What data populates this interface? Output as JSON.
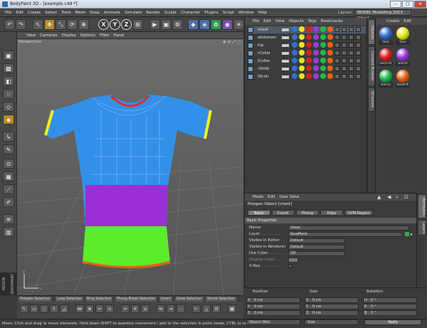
{
  "window": {
    "title": "BodyPaint 3D - [example.c4d *]",
    "min": "–",
    "max": "□",
    "close": "✕"
  },
  "menu": {
    "items": [
      "File",
      "Edit",
      "Create",
      "Select",
      "Tools",
      "Mesh",
      "Snap",
      "Animate",
      "Simulate",
      "Render",
      "Sculpt",
      "Character",
      "Plugins",
      "Script",
      "Window",
      "Help"
    ],
    "layout_label": "Layout:",
    "layout_value": "MODEL Modelling 2013 (User)"
  },
  "toolbar": {
    "icons": [
      "undo-icon",
      "redo-icon",
      "select-arrow-icon",
      "move-icon",
      "scale-icon",
      "rotate-icon",
      "transform-icon",
      "x-axis-icon",
      "y-axis-icon",
      "z-axis-icon",
      "world-coords-icon",
      "render-view-icon",
      "render-picture-icon",
      "edit-render-settings-icon",
      "render-queue-icon",
      "cube-icon",
      "subdivision-icon",
      "array-icon",
      "spline-icon",
      "deformer-icon",
      "scene-icon",
      "light-icon"
    ],
    "x": "X",
    "y": "Y",
    "z": "Z"
  },
  "viewport": {
    "menu": [
      "View",
      "Cameras",
      "Display",
      "Options",
      "Filter",
      "Panel"
    ],
    "label": "Perspective",
    "nav": "✥ ⟳ ⤢ ▢"
  },
  "objects": {
    "menu": [
      "File",
      "Edit",
      "View",
      "Objects",
      "Tags",
      "Bookmarks"
    ],
    "rows": [
      "chest",
      "abdomen",
      "hip",
      "rCollar",
      "lCollar",
      "rShldr",
      "lShldr"
    ]
  },
  "materials": {
    "menu": [
      "Create",
      "Edit"
    ],
    "items": [
      {
        "name": "face",
        "color": "#2f6fd6"
      },
      {
        "name": "face",
        "color": "#e8e81a"
      },
      {
        "name": "neck-sh",
        "color": "#e11d1d"
      },
      {
        "name": "waist2",
        "color": "#9a3be0"
      },
      {
        "name": "waist3",
        "color": "#22b94a"
      },
      {
        "name": "waist-fil",
        "color": "#e8620f"
      }
    ]
  },
  "right_tabs": {
    "t1": "Objects",
    "t2": "Content Browser",
    "t3": "Structure",
    "t4": "Attributes",
    "t5": "Layers"
  },
  "attributes": {
    "menu": [
      "Mode",
      "Edit",
      "User Data"
    ],
    "title": "Polygon Object [chest]",
    "tabs": [
      "Basic",
      "Coord.",
      "Phong",
      "Edge",
      "UVM Region"
    ],
    "section": "Basic Properties",
    "rows": {
      "name_l": "Name",
      "name_v": "chest",
      "layer_l": "Layer . . . . . . . .",
      "layer_v": "NewMesh",
      "vise_l": "Visible in Editor . .",
      "vise_v": "Default",
      "visr_l": "Visible in Renderer",
      "visr_v": "Default",
      "usec_l": "Use Color . . . . . .",
      "usec_v": "Off",
      "dispc_l": "Display Color . . .",
      "xray_l": "X-Ray . . . . . . . ."
    }
  },
  "coordinates": {
    "h1": "Position",
    "h2": "Size",
    "h3": "Rotation",
    "rows": [
      {
        "a": "X",
        "v1": "0 cm",
        "b": "X",
        "v2": "0 cm",
        "c": "H",
        "v3": "0 °"
      },
      {
        "a": "Y",
        "v1": "0 cm",
        "b": "Y",
        "v2": "0 cm",
        "c": "P",
        "v3": "0 °"
      },
      {
        "a": "Z",
        "v1": "0 cm",
        "b": "Z",
        "v2": "0 cm",
        "c": "B",
        "v3": "0 °"
      }
    ],
    "mode": "Object (Rel)",
    "size_mode": "Size",
    "apply": "Apply"
  },
  "bottom_tabs": [
    "Polygon Selection",
    "Loop Selection",
    "Ring Selection",
    "Phong Break Selection",
    "Invert",
    "Grow Selection",
    "Shrink Selection"
  ],
  "brand": "MAXON BODYPAINT 3D",
  "status": "Move: Click and drag to move elements. Hold down SHIFT to quantize movement / add to the selection in point mode, CTRL to remove."
}
